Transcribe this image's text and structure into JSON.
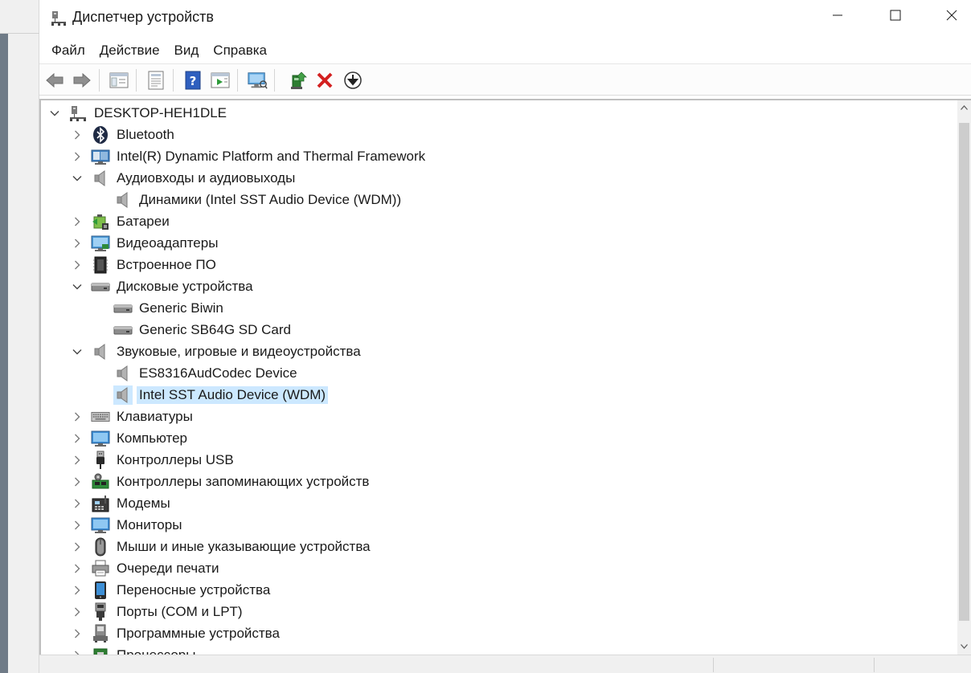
{
  "window": {
    "title": "Диспетчер устройств"
  },
  "menu": [
    {
      "label": "Файл"
    },
    {
      "label": "Действие"
    },
    {
      "label": "Вид"
    },
    {
      "label": "Справка"
    }
  ],
  "toolbar": [
    {
      "icon": "back-arrow-icon"
    },
    {
      "icon": "forward-arrow-icon"
    },
    {
      "icon": "show-hide-console-tree-icon"
    },
    {
      "icon": "properties-icon"
    },
    {
      "icon": "help-icon"
    },
    {
      "icon": "run-action-icon"
    },
    {
      "icon": "scan-hardware-icon"
    },
    {
      "icon": "update-driver-icon"
    },
    {
      "icon": "uninstall-device-icon"
    },
    {
      "icon": "download-driver-icon"
    }
  ],
  "tree": [
    {
      "label": "DESKTOP-HEH1DLE",
      "level": 0,
      "state": "expanded",
      "icon": "computer-network-icon"
    },
    {
      "label": "Bluetooth",
      "level": 1,
      "state": "collapsed",
      "icon": "bluetooth-icon"
    },
    {
      "label": "Intel(R) Dynamic Platform and Thermal Framework",
      "level": 1,
      "state": "collapsed",
      "icon": "monitor-device-icon"
    },
    {
      "label": "Аудиовходы и аудиовыходы",
      "level": 1,
      "state": "expanded",
      "icon": "speaker-icon"
    },
    {
      "label": "Динамики (Intel SST Audio Device (WDM))",
      "level": 2,
      "state": "leaf",
      "icon": "speaker-icon"
    },
    {
      "label": "Батареи",
      "level": 1,
      "state": "collapsed",
      "icon": "battery-icon"
    },
    {
      "label": "Видеоадаптеры",
      "level": 1,
      "state": "collapsed",
      "icon": "display-adapter-icon"
    },
    {
      "label": "Встроенное ПО",
      "level": 1,
      "state": "collapsed",
      "icon": "firmware-chip-icon"
    },
    {
      "label": "Дисковые устройства",
      "level": 1,
      "state": "expanded",
      "icon": "disk-drive-icon"
    },
    {
      "label": "Generic Biwin",
      "level": 2,
      "state": "leaf",
      "icon": "disk-drive-icon"
    },
    {
      "label": "Generic SB64G SD Card",
      "level": 2,
      "state": "leaf",
      "icon": "disk-drive-icon"
    },
    {
      "label": "Звуковые, игровые и видеоустройства",
      "level": 1,
      "state": "expanded",
      "icon": "speaker-icon"
    },
    {
      "label": "ES8316AudCodec Device",
      "level": 2,
      "state": "leaf",
      "icon": "speaker-icon"
    },
    {
      "label": "Intel SST Audio Device (WDM)",
      "level": 2,
      "state": "leaf",
      "icon": "speaker-icon",
      "selected": true
    },
    {
      "label": "Клавиатуры",
      "level": 1,
      "state": "collapsed",
      "icon": "keyboard-icon"
    },
    {
      "label": "Компьютер",
      "level": 1,
      "state": "collapsed",
      "icon": "computer-monitor-icon"
    },
    {
      "label": "Контроллеры USB",
      "level": 1,
      "state": "collapsed",
      "icon": "usb-icon"
    },
    {
      "label": "Контроллеры запоминающих устройств",
      "level": 1,
      "state": "collapsed",
      "icon": "storage-controller-icon"
    },
    {
      "label": "Модемы",
      "level": 1,
      "state": "collapsed",
      "icon": "modem-icon"
    },
    {
      "label": "Мониторы",
      "level": 1,
      "state": "collapsed",
      "icon": "monitor-icon"
    },
    {
      "label": "Мыши и иные указывающие устройства",
      "level": 1,
      "state": "collapsed",
      "icon": "mouse-icon"
    },
    {
      "label": "Очереди печати",
      "level": 1,
      "state": "collapsed",
      "icon": "printer-icon"
    },
    {
      "label": "Переносные устройства",
      "level": 1,
      "state": "collapsed",
      "icon": "portable-device-icon"
    },
    {
      "label": "Порты (COM и LPT)",
      "level": 1,
      "state": "collapsed",
      "icon": "port-icon"
    },
    {
      "label": "Программные устройства",
      "level": 1,
      "state": "collapsed",
      "icon": "software-device-icon"
    },
    {
      "label": "Процессоры",
      "level": 1,
      "state": "collapsed",
      "icon": "processor-icon"
    }
  ]
}
